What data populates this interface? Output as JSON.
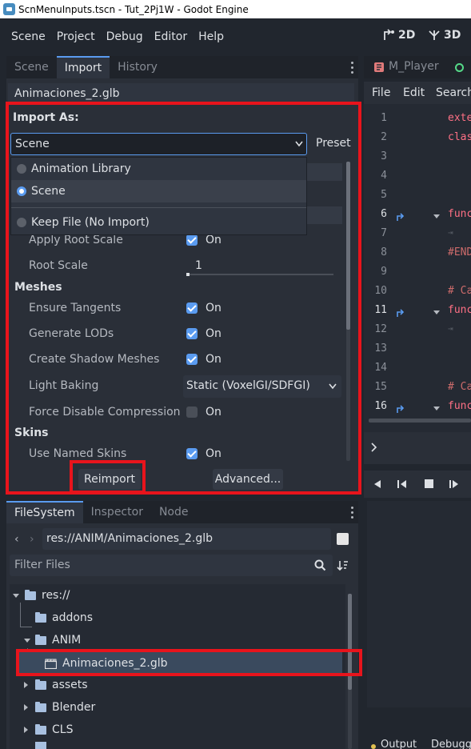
{
  "window": {
    "title": "ScnMenuInputs.tscn - Tut_2Pj1W - Godot Engine"
  },
  "menubar": {
    "items": [
      "Scene",
      "Project",
      "Debug",
      "Editor",
      "Help"
    ],
    "mode_2d": "2D",
    "mode_3d": "3D"
  },
  "import_dock": {
    "tabs": [
      "Scene",
      "Import",
      "History"
    ],
    "active_tab": "Import",
    "filename": "Animaciones_2.glb",
    "import_as_label": "Import As:",
    "import_as_value": "Scene",
    "preset_label": "Preset",
    "popup_options": [
      {
        "label": "Animation Library",
        "selected": false
      },
      {
        "label": "Scene",
        "selected": true
      },
      {
        "label": "Keep File (No Import)",
        "selected": false
      }
    ],
    "rows": {
      "apply_root_scale": {
        "label": "Apply Root Scale",
        "value": "On"
      },
      "root_scale": {
        "label": "Root Scale",
        "value": "1"
      },
      "meshes_section": "Meshes",
      "ensure_tangents": {
        "label": "Ensure Tangents",
        "value": "On"
      },
      "generate_lods": {
        "label": "Generate LODs",
        "value": "On"
      },
      "create_shadow_meshes": {
        "label": "Create Shadow Meshes",
        "value": "On"
      },
      "light_baking": {
        "label": "Light Baking",
        "value": "Static (VoxelGI/SDFGI)"
      },
      "force_disable_compression": {
        "label": "Force Disable Compression",
        "value": "On"
      },
      "skins_section": "Skins",
      "use_named_skins": {
        "label": "Use Named Skins",
        "value": "On"
      }
    },
    "reimport_label": "Reimport",
    "advanced_label": "Advanced..."
  },
  "filesystem_dock": {
    "tabs": [
      "FileSystem",
      "Inspector",
      "Node"
    ],
    "active_tab": "FileSystem",
    "path": "res://ANIM/Animaciones_2.glb",
    "filter_placeholder": "Filter Files",
    "tree": [
      {
        "label": "res://",
        "type": "folder",
        "expanded": true
      },
      {
        "label": "addons",
        "type": "folder"
      },
      {
        "label": "ANIM",
        "type": "folder",
        "expanded": true
      },
      {
        "label": "Animaciones_2.glb",
        "type": "scene-file",
        "selected": true
      },
      {
        "label": "assets",
        "type": "folder"
      },
      {
        "label": "Blender",
        "type": "folder"
      },
      {
        "label": "CLS",
        "type": "folder"
      }
    ]
  },
  "script_editor": {
    "tab_label": "M_Player",
    "menu": [
      "File",
      "Edit",
      "Search"
    ],
    "line_numbers": [
      "1",
      "2",
      "3",
      "4",
      "5",
      "6",
      "7",
      "8",
      "9",
      "10",
      "11",
      "12",
      "13",
      "14",
      "15",
      "16"
    ],
    "code_fragments": {
      "l1": "exte",
      "l2": "clas",
      "l6": "func",
      "l8": "#END",
      "l10": "# Ca",
      "l11": "func",
      "l15": "# Ca",
      "l16": "func"
    },
    "bottom_tabs": [
      "Output",
      "Debugger"
    ]
  },
  "colors": {
    "accent": "#5a9bf0",
    "highlight_box": "#e8141c",
    "keyword": "#ff7085",
    "comment": "#cd6b6b"
  }
}
